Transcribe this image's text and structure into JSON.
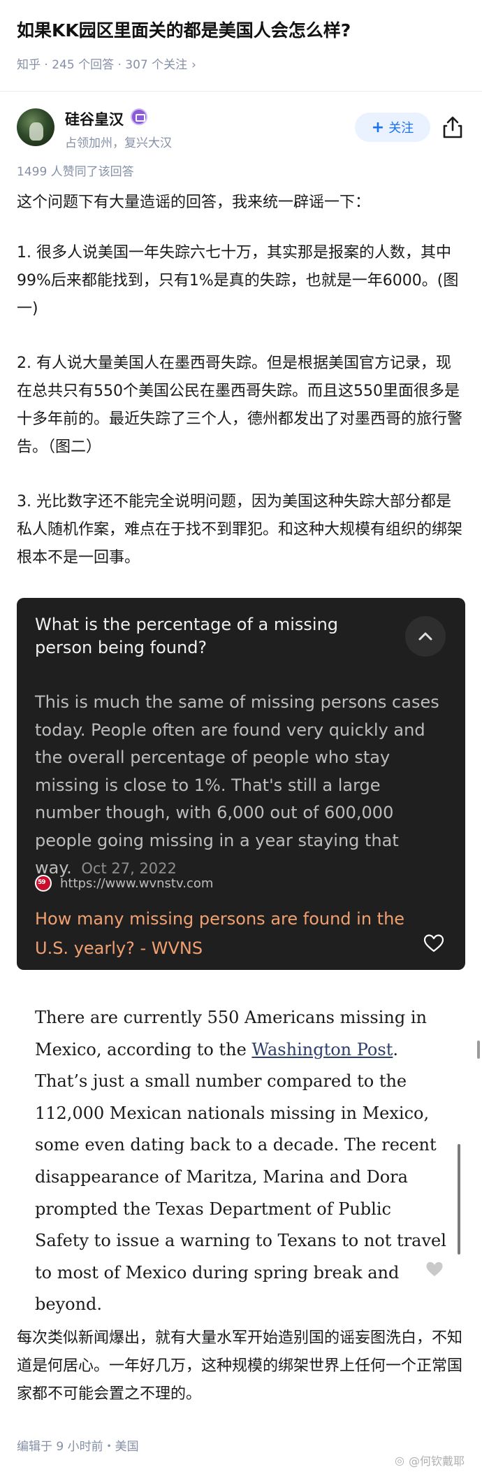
{
  "question": {
    "title": "如果KK园区里面关的都是美国人会怎么样?",
    "meta": "知乎 · 245 个回答 · 307 个关注"
  },
  "author": {
    "name": "硅谷皇汉",
    "description": "占领加州，复兴大汉",
    "follow_label": "关注"
  },
  "answer": {
    "upvotes": "1499 人赞同了该回答",
    "paragraphs": [
      "这个问题下有大量造谣的回答，我来统一辟谣一下：",
      "1. 很多人说美国一年失踪六七十万，其实那是报案的人数，其中99%后来都能找到，只有1%是真的失踪，也就是一年6000。(图一)",
      "2. 有人说大量美国人在墨西哥失踪。但是根据美国官方记录，现在总共只有550个美国公民在墨西哥失踪。而且这550里面很多是十多年前的。最近失踪了三个人，德州都发出了对墨西哥的旅行警告。（图二）",
      "3. 光比数字还不能完全说明问题，因为美国这种失踪大部分都是私人随机作案，难点在于找不到罪犯。和这种大规模有组织的绑架根本不是一回事。"
    ],
    "closing": "每次类似新闻爆出，就有大量水军开始造别国的谣妄图洗白，不知道是何居心。一年好几万，这种规模的绑架世界上任何一个正常国家都不可能会置之不理的。",
    "edit_info": "编辑于 9 小时前・美国"
  },
  "image1": {
    "question": "What is the percentage of a missing person being found?",
    "body": "This is much the same of missing persons cases today. People often are found very quickly and the overall percentage of people who stay missing is close to 1%. That's still a large number though, with 6,000 out of 600,000 people going missing in a year staying that way.",
    "date": "Oct 27, 2022",
    "source_url": "https://www.wvnstv.com",
    "link_text": "How many missing persons are found in the U.S. yearly? - WVNS"
  },
  "image2": {
    "text_before": "There are currently 550 Americans missing in Mexico, according to the ",
    "link_text": "Washington Post",
    "text_after": ". That’s just a small number compared to the 112,000 Mexican nationals missing in Mexico, some even dating back to a decade. The recent disappearance of Maritza, Marina and Dora prompted the Texas Department of Public Safety to issue a warning to Texans to not travel to most of Mexico during spring break and beyond."
  },
  "watermark": "@何钦戴耶",
  "icons": {
    "share": "share-icon",
    "collapse": "chevron-up-icon",
    "heart": "heart-icon",
    "badge": "creator-badge-icon"
  },
  "colors": {
    "accent": "#1772f6",
    "meta_text": "#8590a6",
    "card_bg": "#1f1f1f",
    "card_link": "#f0a071"
  }
}
